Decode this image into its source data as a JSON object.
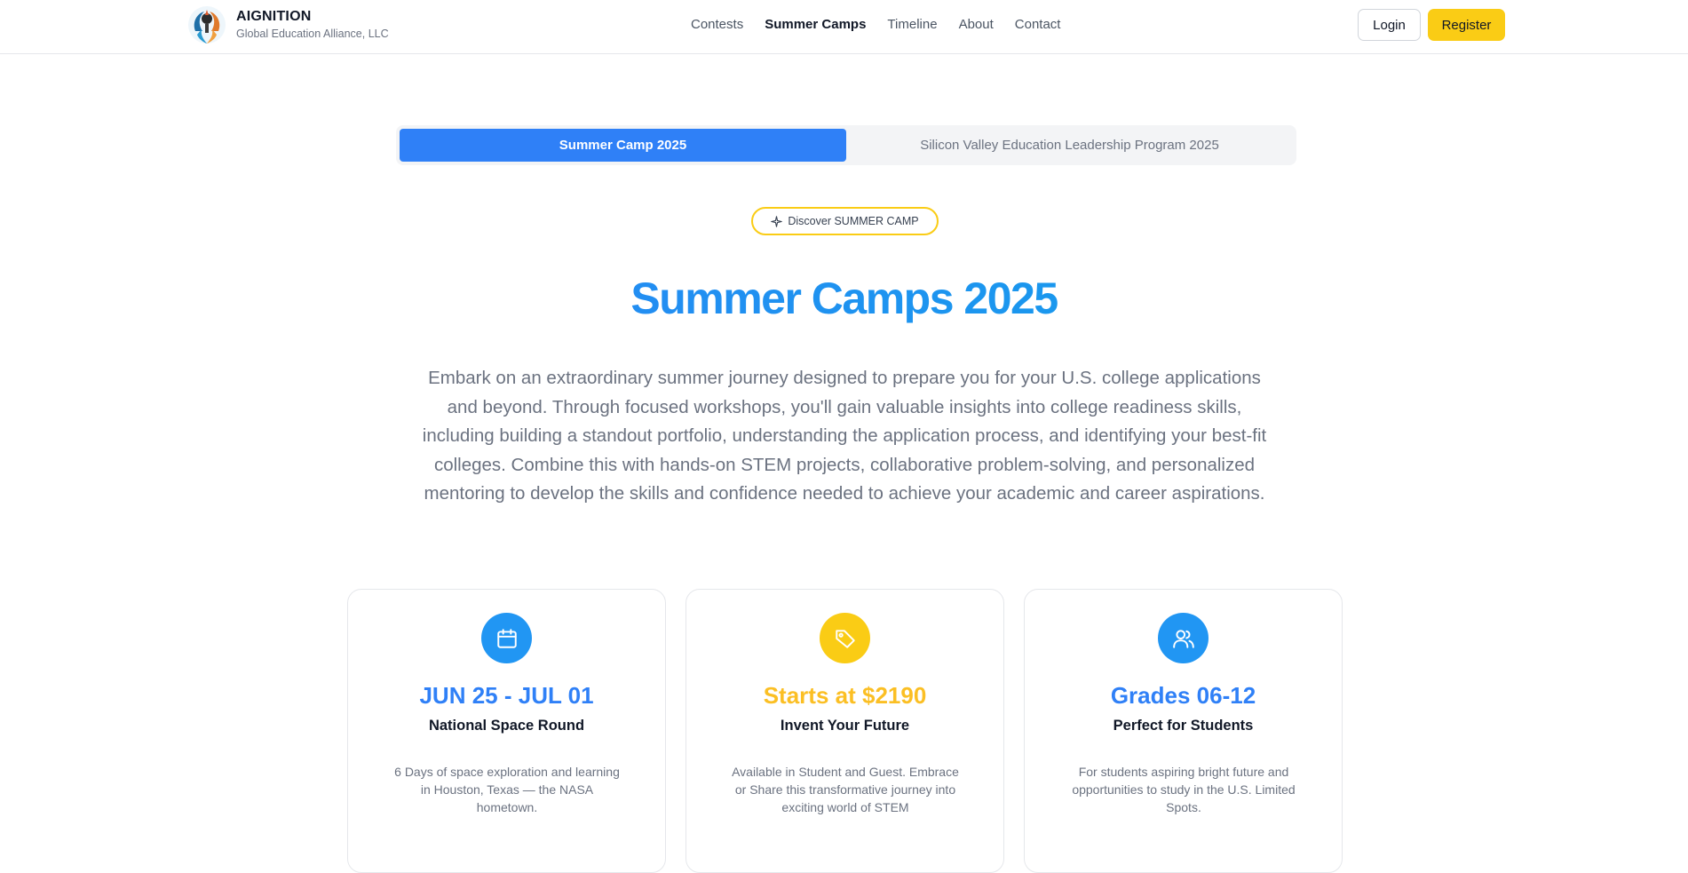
{
  "brand": {
    "name": "AIGNITION",
    "subtitle": "Global Education Alliance, LLC"
  },
  "nav": {
    "items": [
      {
        "label": "Contests",
        "active": false
      },
      {
        "label": "Summer Camps",
        "active": true
      },
      {
        "label": "Timeline",
        "active": false
      },
      {
        "label": "About",
        "active": false
      },
      {
        "label": "Contact",
        "active": false
      }
    ]
  },
  "auth": {
    "login_label": "Login",
    "register_label": "Register"
  },
  "tabs": [
    {
      "label": "Summer Camp 2025",
      "active": true
    },
    {
      "label": "Silicon Valley Education Leadership Program 2025",
      "active": false
    }
  ],
  "badge": {
    "label": "Discover SUMMER CAMP",
    "icon": "sparkle-icon"
  },
  "hero": {
    "title": "Summer Camps 2025",
    "description": "Embark on an extraordinary summer journey designed to prepare you for your U.S. college applications and beyond. Through focused workshops, you'll gain valuable insights into college readiness skills, including building a standout portfolio, understanding the application process, and identifying your best-fit colleges. Combine this with hands-on STEM projects, collaborative problem-solving, and personalized mentoring to develop the skills and confidence needed to achieve your academic and career aspirations."
  },
  "cards": [
    {
      "icon": "calendar-icon",
      "headline": "JUN 25 - JUL 01",
      "subtitle": "National Space Round",
      "body": "6 Days of space exploration and learning in Houston, Texas — the NASA hometown."
    },
    {
      "icon": "tag-icon",
      "headline": "Starts at $2190",
      "subtitle": "Invent Your Future",
      "body": "Available in Student and Guest. Embrace or Share this transformative journey into exciting world of STEM"
    },
    {
      "icon": "users-icon",
      "headline": "Grades 06-12",
      "subtitle": "Perfect for Students",
      "body": "For students aspiring bright future and opportunities to study in the U.S. Limited Spots."
    }
  ],
  "colors": {
    "accent_blue": "#2f80f7",
    "accent_yellow": "#facc15",
    "text_muted": "#6b7280"
  }
}
